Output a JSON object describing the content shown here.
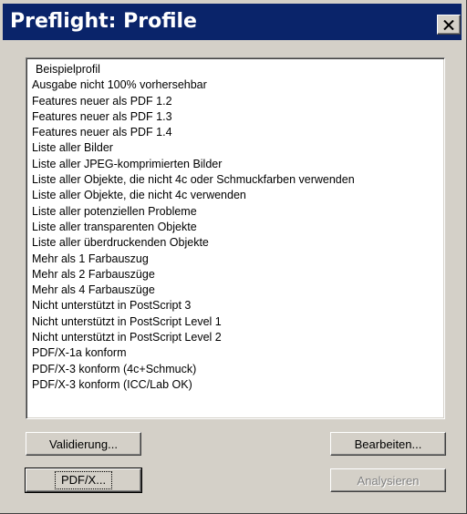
{
  "window": {
    "title": "Preflight: Profile",
    "close_icon": "close-icon"
  },
  "profiles": {
    "items": [
      "Beispielprofil",
      "Ausgabe nicht 100% vorhersehbar",
      "Features neuer als PDF 1.2",
      "Features neuer als PDF 1.3",
      "Features neuer als PDF 1.4",
      "Liste aller Bilder",
      "Liste aller JPEG-komprimierten Bilder",
      "Liste aller Objekte, die nicht 4c oder Schmuckfarben verwenden",
      "Liste aller Objekte, die nicht 4c verwenden",
      "Liste aller potenziellen Probleme",
      "Liste aller transparenten Objekte",
      "Liste aller überdruckenden Objekte",
      "Mehr als 1 Farbauszug",
      "Mehr als 2 Farbauszüge",
      "Mehr als 4 Farbauszüge",
      "Nicht unterstützt in PostScript 3",
      "Nicht unterstützt in PostScript Level 1",
      "Nicht unterstützt in PostScript Level 2",
      "PDF/X-1a konform",
      "PDF/X-3 konform (4c+Schmuck)",
      "PDF/X-3 konform (ICC/Lab OK)"
    ]
  },
  "buttons": {
    "validierung": "Validierung...",
    "bearbeiten": "Bearbeiten...",
    "pdfx": "PDF/X...",
    "analysieren": "Analysieren"
  },
  "colors": {
    "titlebar": "#0a246a",
    "face": "#d4d0c8",
    "disabled_text": "#808080"
  }
}
